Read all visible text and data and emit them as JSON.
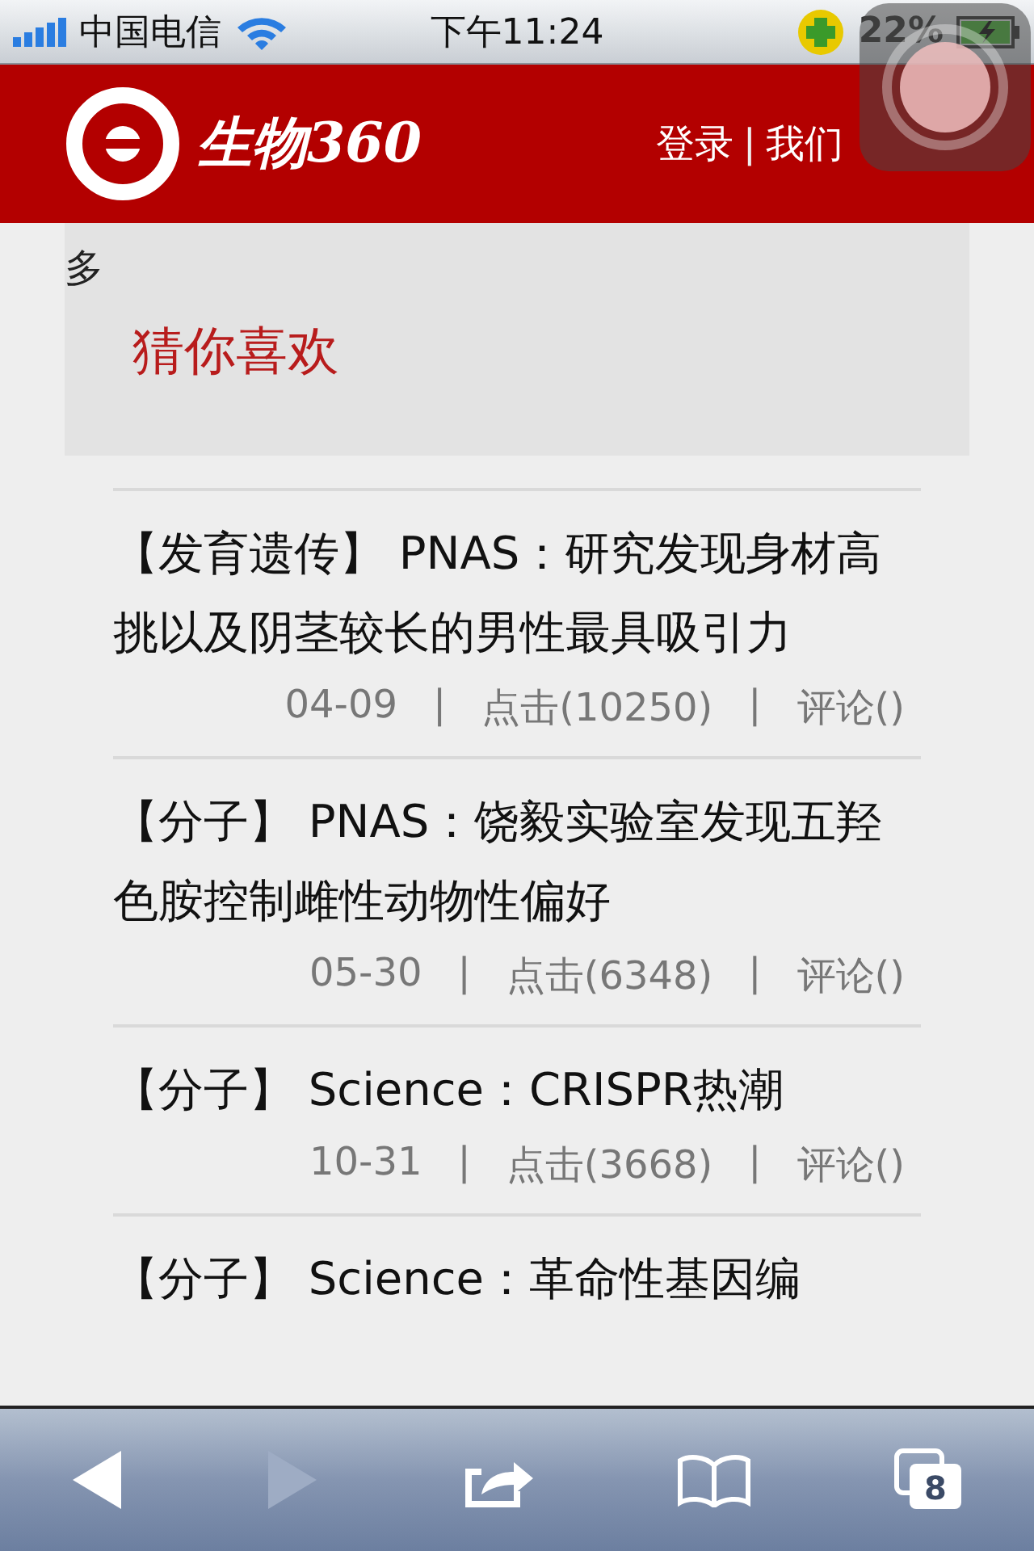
{
  "status_bar": {
    "carrier": "中国电信",
    "time": "下午11:24",
    "battery": "22%",
    "charging": true
  },
  "header": {
    "logo": "生物360",
    "links": [
      "登录",
      "我们"
    ],
    "separator": "|"
  },
  "section": {
    "stray_text": "多",
    "title": "猜你喜欢"
  },
  "articles": [
    {
      "category": "【发育遗传】",
      "title": "PNAS：研究发现身材高挑以及阴茎较长的男性最具吸引力",
      "meta": [
        "04-09",
        "|",
        "点击(10250)",
        "|",
        "评论()"
      ]
    },
    {
      "category": "【分子】",
      "title": "PNAS：饶毅实验室发现五羟色胺控制雌性动物性偏好",
      "meta": [
        "05-30",
        "|",
        "点击(6348)",
        "|",
        "评论()"
      ]
    },
    {
      "category": "【分子】",
      "title": "Science：CRISPR热潮",
      "meta": [
        "10-31",
        "|",
        "点击(3668)",
        "|",
        "评论()"
      ]
    },
    {
      "category": "【分子】",
      "title": "Science：革命性基因编"
    }
  ],
  "toolbar": {
    "back_disabled": false,
    "forward_disabled": true,
    "tab_count": "8"
  }
}
